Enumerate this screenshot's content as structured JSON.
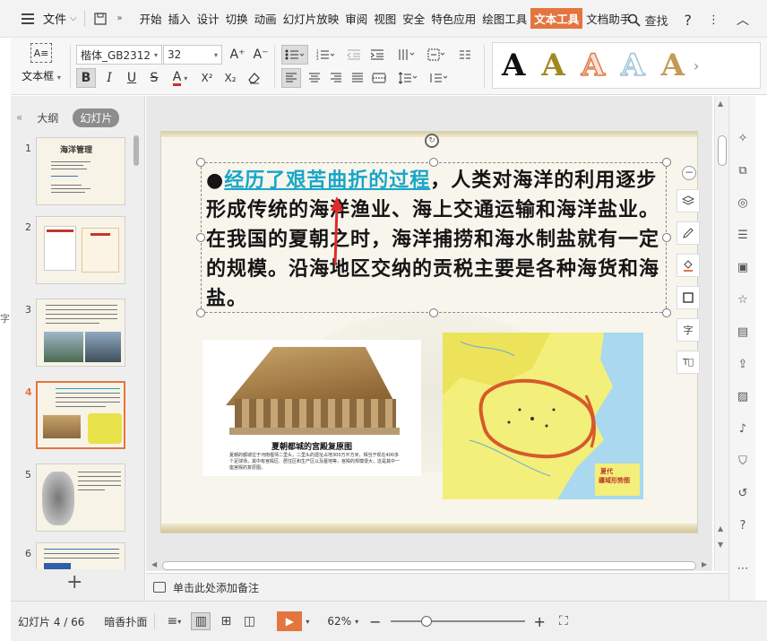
{
  "menubar": {
    "file_label": "文件",
    "tabs": [
      "开始",
      "插入",
      "设计",
      "切换",
      "动画",
      "幻灯片放映",
      "审阅",
      "视图",
      "安全",
      "特色应用",
      "绘图工具",
      "文本工具",
      "文档助手"
    ],
    "active_tab": "文本工具",
    "search_label": "查找",
    "help_label": "?",
    "collapse_label": "︿"
  },
  "ribbon": {
    "textbox_label": "文本框",
    "textbox_icon_text": "A≡",
    "font_name": "楷体_GB2312",
    "font_size": "32",
    "grow_label": "A⁺",
    "shrink_label": "A⁻",
    "bold": "B",
    "italic": "I",
    "underline": "U",
    "strike": "S",
    "font_color": "A",
    "superscript": "X²",
    "subscript": "X₂",
    "style_colors": [
      "#111111",
      "#a08a20",
      "#e07a4a",
      "#9fc3da",
      "#c39a58"
    ]
  },
  "leftpanel": {
    "tab_outline": "大纲",
    "tab_slides": "幻灯片",
    "slides": [
      {
        "num": "1",
        "title": "海洋管理"
      },
      {
        "num": "2",
        "title": ""
      },
      {
        "num": "3",
        "title": ""
      },
      {
        "num": "4",
        "title": ""
      },
      {
        "num": "5",
        "title": ""
      },
      {
        "num": "6",
        "title": ""
      }
    ],
    "active_slide": "4",
    "add_label": "+"
  },
  "slide": {
    "bullet": "●",
    "highlight": "经历了艰苦曲折的过程",
    "body_rest": "，人类对海洋的利用逐步形成传统的海洋渔业、海上交通运输和海洋盐业。在我国的夏朝之时，海洋捕捞和海水制盐就有一定的规模。沿海地区交纳的贡税主要是各种海货和海盐。",
    "house_caption": "夏朝都城的宫殿复原图",
    "house_desc": "夏朝的都城位于河南偃师二里头，二里头的遗址占地300万平方米，相当于现在400多个足球场，其中有宫殿区、居住区和生产区以及墓地等，宫殿的规模很大，这是其中一座宫殿的复原图。",
    "map_label_1": "夏代",
    "map_label_2": "疆域形势图"
  },
  "notes": {
    "placeholder": "单击此处添加备注"
  },
  "statusbar": {
    "slide_counter": "幻灯片 4 / 66",
    "theme_name": "暗香扑面",
    "zoom_level": "62%",
    "zoom_fraction": 0.27,
    "zoom_minus": "−",
    "zoom_plus": "+"
  },
  "colors": {
    "accent": "#e3753e",
    "link": "#18a6c8"
  }
}
